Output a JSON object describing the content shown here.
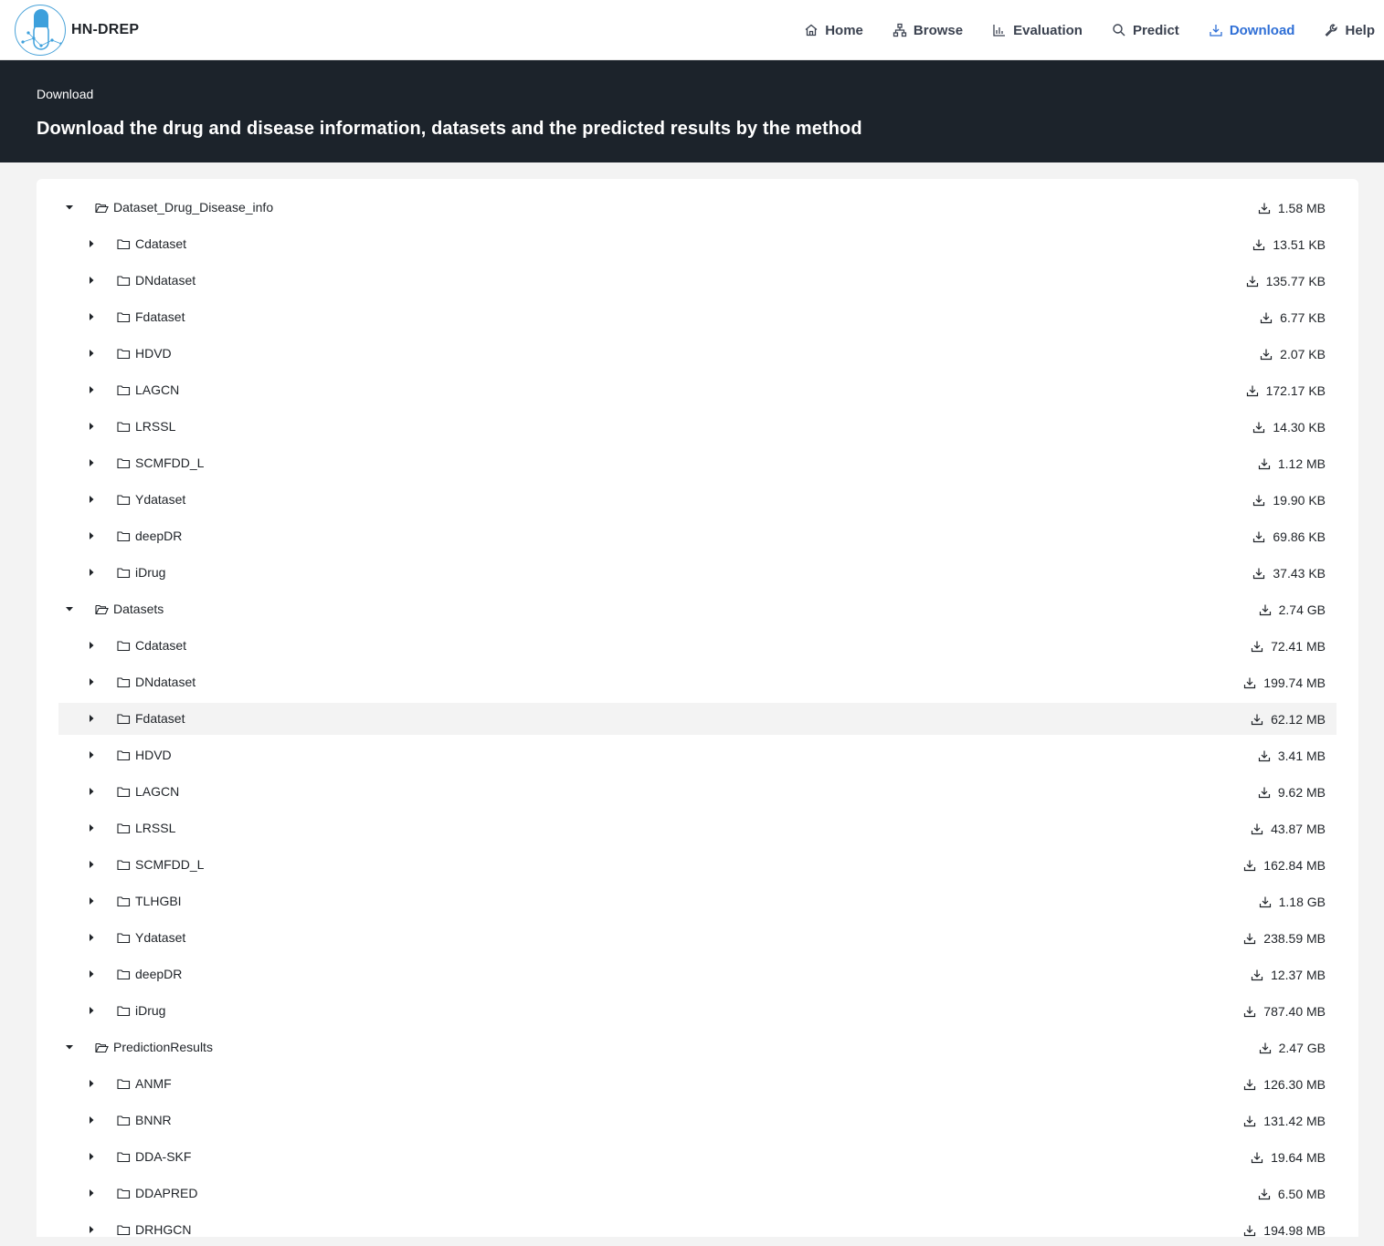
{
  "brand": {
    "name": "HN-DREP"
  },
  "nav": {
    "items": [
      {
        "label": "Home",
        "icon": "home-icon"
      },
      {
        "label": "Browse",
        "icon": "sitemap-icon"
      },
      {
        "label": "Evaluation",
        "icon": "bar-chart-icon"
      },
      {
        "label": "Predict",
        "icon": "search-icon"
      },
      {
        "label": "Download",
        "icon": "download-icon",
        "active": true
      },
      {
        "label": "Help",
        "icon": "wrench-icon"
      }
    ],
    "active_color": "#2f6fd6"
  },
  "hero": {
    "breadcrumb": "Download",
    "title": "Download the drug and disease information, datasets and the predicted results by the method"
  },
  "tree": {
    "rows": [
      {
        "level": 0,
        "expanded": true,
        "label": "Dataset_Drug_Disease_info",
        "size": "1.58 MB"
      },
      {
        "level": 1,
        "expanded": false,
        "label": "Cdataset",
        "size": "13.51 KB"
      },
      {
        "level": 1,
        "expanded": false,
        "label": "DNdataset",
        "size": "135.77 KB"
      },
      {
        "level": 1,
        "expanded": false,
        "label": "Fdataset",
        "size": "6.77 KB"
      },
      {
        "level": 1,
        "expanded": false,
        "label": "HDVD",
        "size": "2.07 KB"
      },
      {
        "level": 1,
        "expanded": false,
        "label": "LAGCN",
        "size": "172.17 KB"
      },
      {
        "level": 1,
        "expanded": false,
        "label": "LRSSL",
        "size": "14.30 KB"
      },
      {
        "level": 1,
        "expanded": false,
        "label": "SCMFDD_L",
        "size": "1.12 MB"
      },
      {
        "level": 1,
        "expanded": false,
        "label": "Ydataset",
        "size": "19.90 KB"
      },
      {
        "level": 1,
        "expanded": false,
        "label": "deepDR",
        "size": "69.86 KB"
      },
      {
        "level": 1,
        "expanded": false,
        "label": "iDrug",
        "size": "37.43 KB"
      },
      {
        "level": 0,
        "expanded": true,
        "label": "Datasets",
        "size": "2.74 GB"
      },
      {
        "level": 1,
        "expanded": false,
        "label": "Cdataset",
        "size": "72.41 MB"
      },
      {
        "level": 1,
        "expanded": false,
        "label": "DNdataset",
        "size": "199.74 MB"
      },
      {
        "level": 1,
        "expanded": false,
        "label": "Fdataset",
        "size": "62.12 MB",
        "highlight": true
      },
      {
        "level": 1,
        "expanded": false,
        "label": "HDVD",
        "size": "3.41 MB"
      },
      {
        "level": 1,
        "expanded": false,
        "label": "LAGCN",
        "size": "9.62 MB"
      },
      {
        "level": 1,
        "expanded": false,
        "label": "LRSSL",
        "size": "43.87 MB"
      },
      {
        "level": 1,
        "expanded": false,
        "label": "SCMFDD_L",
        "size": "162.84 MB"
      },
      {
        "level": 1,
        "expanded": false,
        "label": "TLHGBI",
        "size": "1.18 GB"
      },
      {
        "level": 1,
        "expanded": false,
        "label": "Ydataset",
        "size": "238.59 MB"
      },
      {
        "level": 1,
        "expanded": false,
        "label": "deepDR",
        "size": "12.37 MB"
      },
      {
        "level": 1,
        "expanded": false,
        "label": "iDrug",
        "size": "787.40 MB"
      },
      {
        "level": 0,
        "expanded": true,
        "label": "PredictionResults",
        "size": "2.47 GB"
      },
      {
        "level": 1,
        "expanded": false,
        "label": "ANMF",
        "size": "126.30 MB"
      },
      {
        "level": 1,
        "expanded": false,
        "label": "BNNR",
        "size": "131.42 MB"
      },
      {
        "level": 1,
        "expanded": false,
        "label": "DDA-SKF",
        "size": "19.64 MB"
      },
      {
        "level": 1,
        "expanded": false,
        "label": "DDAPRED",
        "size": "6.50 MB"
      },
      {
        "level": 1,
        "expanded": false,
        "label": "DRHGCN",
        "size": "194.98 MB"
      }
    ]
  }
}
